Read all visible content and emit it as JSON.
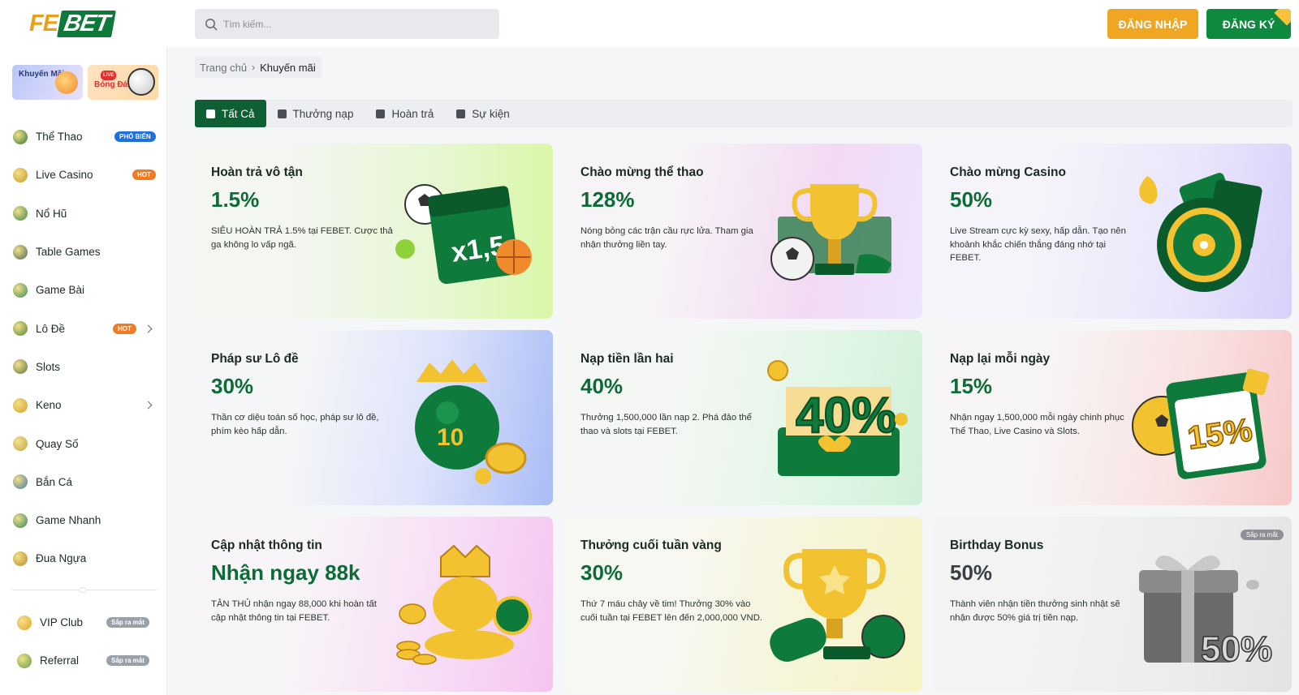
{
  "header": {
    "logo_fe": "FE",
    "logo_bet": "BET",
    "search_placeholder": "Tìm kiếm...",
    "login_label": "ĐĂNG NHẬP",
    "register_label": "ĐĂNG KÝ"
  },
  "sidebar": {
    "banners": [
      {
        "label": "Khuyến Mãi"
      },
      {
        "label": "Bóng Đá",
        "tag": "LIVE"
      }
    ],
    "items": [
      {
        "label": "Thể Thao",
        "badge": "PHỔ BIẾN",
        "icon": "sports-icon",
        "color": "#2f7a3a"
      },
      {
        "label": "Live Casino",
        "badge": "HOT",
        "icon": "live-casino-icon",
        "color": "#c89a21"
      },
      {
        "label": "Nổ Hũ",
        "icon": "jackpot-icon",
        "color": "#3b8a4a"
      },
      {
        "label": "Table Games",
        "icon": "table-games-icon",
        "color": "#4a6a55"
      },
      {
        "label": "Game Bài",
        "icon": "card-game-icon",
        "color": "#3e8d5b"
      },
      {
        "label": "Lô Đề",
        "badge": "HOT",
        "icon": "lottery-icon",
        "color": "#4e8a39",
        "has_submenu": true
      },
      {
        "label": "Slots",
        "icon": "slots-icon",
        "color": "#5c7a40"
      },
      {
        "label": "Keno",
        "icon": "keno-icon",
        "color": "#d6a21e",
        "has_submenu": true
      },
      {
        "label": "Quay Số",
        "icon": "spin-icon",
        "color": "#c7a64b"
      },
      {
        "label": "Bắn Cá",
        "icon": "fishing-icon",
        "color": "#3f7c9e"
      },
      {
        "label": "Game Nhanh",
        "icon": "quick-game-icon",
        "color": "#2e8a5e"
      },
      {
        "label": "Đua Ngựa",
        "icon": "horse-racing-icon",
        "color": "#b98a2a"
      }
    ],
    "extra_items": [
      {
        "label": "VIP Club",
        "badge": "Sắp ra mắt",
        "icon": "crown-icon",
        "color": "#e2a52a"
      },
      {
        "label": "Referral",
        "badge": "Sắp ra mắt",
        "icon": "referral-icon",
        "color": "#5ba14a"
      }
    ]
  },
  "breadcrumb": {
    "home": "Trang chủ",
    "separator": "›",
    "current": "Khuyến mãi"
  },
  "tabs": [
    {
      "label": "Tất Cả",
      "active": true
    },
    {
      "label": "Thưởng nạp"
    },
    {
      "label": "Hoàn trả"
    },
    {
      "label": "Sự kiện"
    }
  ],
  "promotions": [
    {
      "title": "Hoàn trả vô tận",
      "value": "1.5%",
      "desc": "SIÊU HOÀN TRẢ 1.5% tại FEBET. Cược thả ga không lo vấp ngã.",
      "art": "calendar-ball-icon",
      "art_text": "x1,5"
    },
    {
      "title": "Chào mừng thể thao",
      "value": "128%",
      "desc": "Nóng bỏng các trận cầu rực lửa. Tham gia nhận thưởng liền tay.",
      "art": "trophy-icon"
    },
    {
      "title": "Chào mừng Casino",
      "value": "50%",
      "desc": "Live Stream cực kỳ sexy, hấp dẫn. Tạo nên khoảnh khắc chiến thắng đáng nhớ tại FEBET.",
      "art": "roulette-icon"
    },
    {
      "title": "Pháp sư Lô đề",
      "value": "30%",
      "desc": "Thần cơ diệu toán số học, pháp sư lô đề, phím kèo hấp dẫn.",
      "art": "lottery-ball-icon"
    },
    {
      "title": "Nạp tiền lần hai",
      "value": "40%",
      "desc": "Thưởng 1,500,000 lần nạp 2. Phá đảo thể thao và slots tại FEBET.",
      "art": "gift-box-icon",
      "art_text": "40%"
    },
    {
      "title": "Nạp lại mỗi ngày",
      "value": "15%",
      "desc": "Nhận ngay 1,500,000 mỗi ngày chinh phục Thể Thao, Live Casino và Slots.",
      "art": "calendar-icon",
      "art_text": "15%"
    },
    {
      "title": "Cập nhật thông tin",
      "value": "Nhận ngay 88k",
      "desc": "TÂN THỦ nhận ngay 88,000 khi hoàn tất cập nhật thông tin tại FEBET.",
      "art": "coins-crown-icon"
    },
    {
      "title": "Thưởng cuối tuần vàng",
      "value": "30%",
      "desc": "Thứ 7 máu chảy về tim! Thưởng 30% vào cuối tuần tại FEBET lên đến 2,000,000 VND.",
      "art": "trophy-gamepad-icon"
    },
    {
      "title": "Birthday Bonus",
      "value": "50%",
      "desc": "Thành viên nhận tiền thưởng sinh nhật sẽ nhận được 50% giá trị tiền nạp.",
      "art": "birthday-gift-icon",
      "art_text": "50%",
      "soon": "Sắp ra mắt",
      "disabled": true
    }
  ],
  "colors": {
    "brand_green": "#0e6b37",
    "brand_orange": "#f0a623",
    "tab_active": "#0e5f33"
  }
}
